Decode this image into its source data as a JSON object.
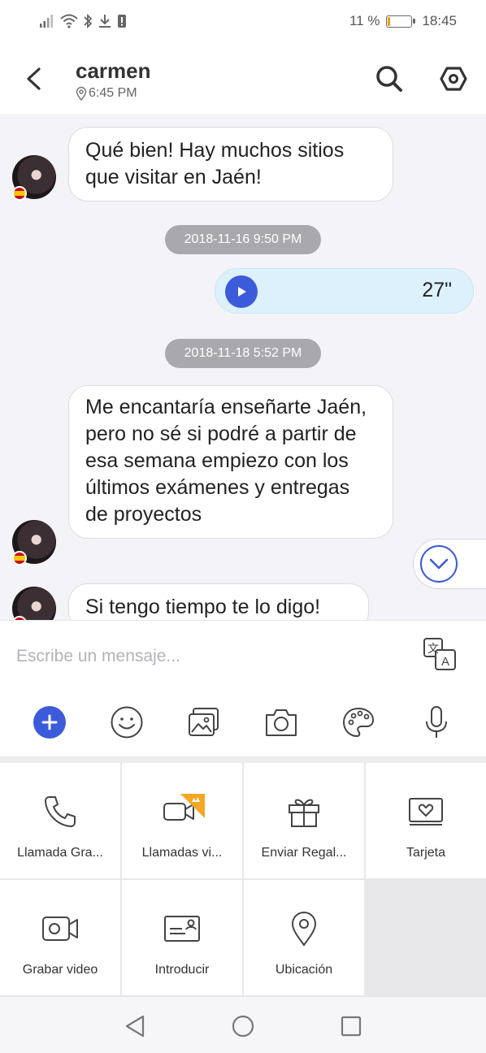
{
  "status_bar": {
    "battery_percent_text": "11 %",
    "battery_level": 0.11,
    "time": "18:45",
    "icons": [
      "signal-icon",
      "wifi-icon",
      "bluetooth-icon",
      "download-icon",
      "alert-icon"
    ]
  },
  "header": {
    "contact_name": "carmen",
    "local_time": "6:45 PM",
    "icons": [
      "back-icon",
      "location-pin-icon",
      "search-icon",
      "settings-icon"
    ]
  },
  "chat": {
    "messages": [
      {
        "type": "incoming",
        "text": "Qué bien! Hay muchos sitios que visitar en Jaén!"
      },
      {
        "type": "timestamp",
        "text": "2018-11-16 9:50 PM"
      },
      {
        "type": "outgoing-voice",
        "duration": "27\""
      },
      {
        "type": "timestamp",
        "text": "2018-11-18 5:52 PM"
      },
      {
        "type": "incoming",
        "text": "Me encantaría enseñarte Jaén, pero no sé si podré a partir de esa semana empiezo con los últimos exámenes y entregas de proyectos"
      },
      {
        "type": "incoming",
        "text": "Si tengo tiempo te lo digo!"
      }
    ]
  },
  "composer": {
    "placeholder": "Escribe un mensaje...",
    "value": "",
    "toolbar_icons": [
      "plus-icon",
      "emoji-icon",
      "gallery-icon",
      "camera-icon",
      "palette-icon",
      "microphone-icon"
    ]
  },
  "actions": [
    {
      "label": "Llamada Gra...",
      "icon": "phone-icon"
    },
    {
      "label": "Llamadas vi...",
      "icon": "video-call-icon"
    },
    {
      "label": "Enviar Regal...",
      "icon": "gift-icon"
    },
    {
      "label": "Tarjeta",
      "icon": "heart-card-icon"
    },
    {
      "label": "Grabar video",
      "icon": "record-video-icon"
    },
    {
      "label": "Introducir",
      "icon": "contact-card-icon"
    },
    {
      "label": "Ubicación",
      "icon": "location-icon"
    }
  ],
  "colors": {
    "accent": "#3b5bdb",
    "chat_background": "#f3f3f8",
    "voice_bubble": "#ddf1fc",
    "timestamp_pill": "#a9a9ad",
    "battery": "#f39c12",
    "premium_badge": "#f5a623"
  }
}
